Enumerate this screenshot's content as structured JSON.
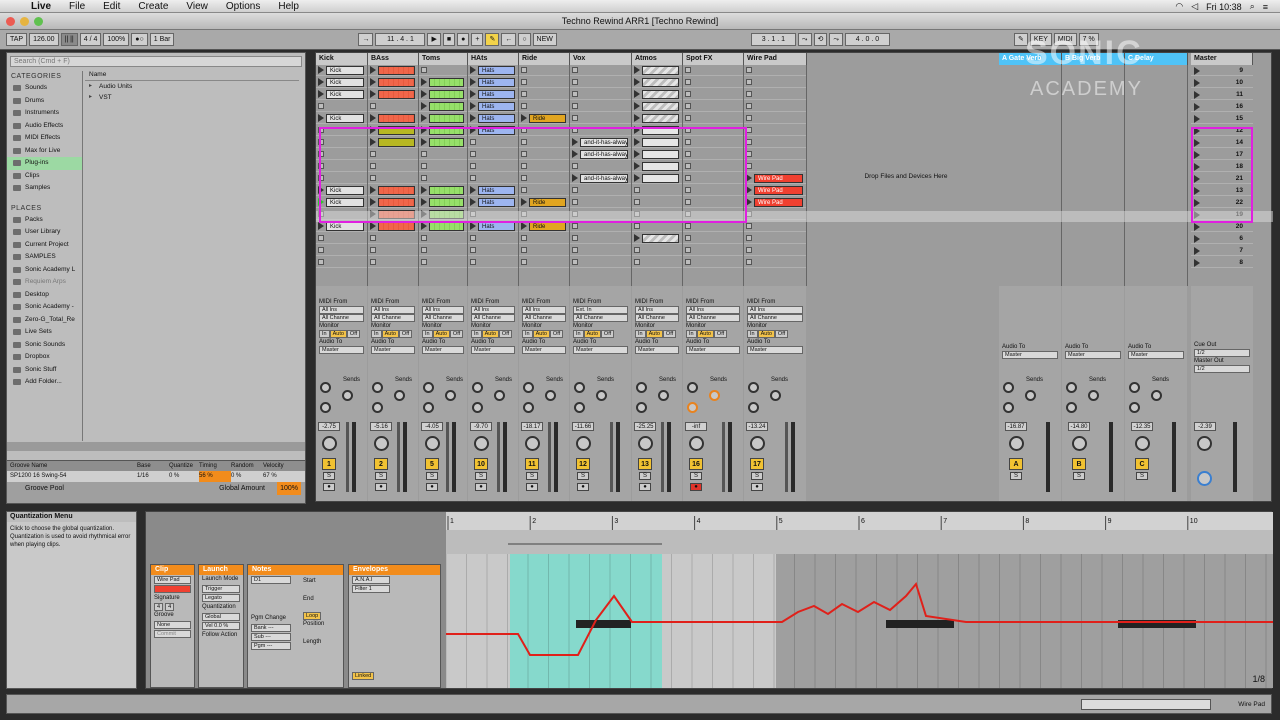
{
  "menubar": {
    "app": "Live",
    "items": [
      "File",
      "Edit",
      "Create",
      "View",
      "Options",
      "Help"
    ],
    "clock": "Fri 10:38"
  },
  "window": {
    "title": "Techno Rewind ARR1  [Techno Rewind]"
  },
  "controlbar": {
    "tap": "TAP",
    "tempo": "126.00",
    "signature": "4 / 4",
    "zoom": "100%",
    "quantize": "1 Bar",
    "position": "11 .  4 .  1",
    "loop_start": "3 .  1 .  1",
    "loop_length": "4 .  0 .  0",
    "new": "NEW",
    "key": "KEY",
    "midi": "MIDI",
    "cpu": "7 %"
  },
  "browser": {
    "search_placeholder": "Search (Cmd + F)",
    "categories_label": "CATEGORIES",
    "categories": [
      "Sounds",
      "Drums",
      "Instruments",
      "Audio Effects",
      "MIDI Effects",
      "Max for Live",
      "Plug-ins",
      "Clips",
      "Samples"
    ],
    "places_label": "PLACES",
    "places": [
      "Packs",
      "User Library",
      "Current Project",
      "SAMPLES",
      "Sonic Academy L",
      "Requiem Arps",
      "Desktop",
      "Sonic Academy -",
      "Zero-G_Total_Re",
      "Live Sets",
      "Sonic Sounds",
      "Dropbox",
      "Sonic Stuff",
      "Add Folder..."
    ],
    "name_header": "Name",
    "items": [
      "Audio Units",
      "VST"
    ]
  },
  "groove": {
    "headers": [
      "Groove Name",
      "Base",
      "Quantize",
      "Timing",
      "Random",
      "Velocity"
    ],
    "row": [
      "SP1200 16 Swing-54",
      "1/16",
      "0 %",
      "56 %",
      "0 %",
      "67 %"
    ],
    "pool": "Groove Pool",
    "global_amount_label": "Global Amount",
    "global_amount": "100%"
  },
  "tracks": [
    {
      "name": "Kick",
      "color": "#d8d8d8",
      "num": "1",
      "vol": "-2.75"
    },
    {
      "name": "BAss",
      "color": "#f0664a",
      "num": "2",
      "vol": "-5.16"
    },
    {
      "name": "Toms",
      "color": "#96e06a",
      "num": "5",
      "vol": "-4.05"
    },
    {
      "name": "HAts",
      "color": "#9db5f0",
      "num": "10",
      "vol": "-9.70"
    },
    {
      "name": "Ride",
      "color": "#e1a520",
      "num": "11",
      "vol": "-18.17"
    },
    {
      "name": "Vox",
      "color": "#d8d8d8",
      "num": "12",
      "vol": "-11.66"
    },
    {
      "name": "Atmos",
      "color": "#e6e6e6",
      "num": "13",
      "vol": "-25.25"
    },
    {
      "name": "Spot FX",
      "color": "#d8d8d8",
      "num": "16",
      "vol": "-inf"
    },
    {
      "name": "Wire Pad",
      "color": "#f04030",
      "num": "17",
      "vol": "-13.24"
    }
  ],
  "clips": {
    "kick": "Kick",
    "hats": "Hats",
    "ride": "Ride",
    "vox": "and-it-has-alway",
    "wire": "Wire Pad"
  },
  "drop_text": "Drop Files and Devices Here",
  "returns": [
    {
      "name": "A Gate Verb",
      "letter": "A",
      "vol": "-16.87"
    },
    {
      "name": "B Big Verb",
      "letter": "B",
      "vol": "-14.80"
    },
    {
      "name": "C Delay",
      "letter": "C",
      "vol": "-12.35"
    }
  ],
  "master": {
    "name": "Master",
    "vol": "-2.39",
    "scenes": [
      "9",
      "10",
      "11",
      "16",
      "15",
      "12",
      "14",
      "17",
      "18",
      "21",
      "13",
      "22",
      "19",
      "20",
      "6",
      "7",
      "8"
    ],
    "cue_out": "Cue Out",
    "master_out": "Master Out",
    "io": "1/2"
  },
  "mixer_labels": {
    "midi_from": "MIDI From",
    "all_ins": "All Ins",
    "all_channels": "All Channe",
    "monitor": "Monitor",
    "in": "In",
    "auto": "Auto",
    "off": "Off",
    "audio_to": "Audio To",
    "master": "Master",
    "sends": "Sends",
    "ext_in": "Ext. In"
  },
  "info": {
    "title": "Quantization Menu",
    "text": "Click to choose the global quantization. Quantization is used to avoid rhythmical error when playing clips."
  },
  "clipview": {
    "clip_title": "Clip",
    "clip_name": "Wire Pad",
    "signature_label": "Signature",
    "sig_num": "4",
    "sig_den": "4",
    "groove_label": "Groove",
    "groove_val": "None",
    "commit": "Commit",
    "launch_title": "Launch",
    "launch_mode_label": "Launch Mode",
    "launch_mode": "Trigger",
    "legato": "Legato",
    "quantization_label": "Quantization",
    "quantization": "Global",
    "vel": "Vel  0.0 %",
    "follow_action": "Follow Action",
    "notes_title": "Notes",
    "note_range": "D1",
    "pgm_change": "Pgm Change",
    "bank": "Bank ---",
    "sub": "Sub ---",
    "pgm": "Pgm ---",
    "start": "Start",
    "end": "End",
    "loop": "Loop",
    "position": "Position",
    "length": "Length",
    "env_title": "Envelopes",
    "env_src": "A.N.A.I",
    "env_ctrl": "Filter 1",
    "linked": "Linked",
    "page": "1/8",
    "ruler": [
      "1",
      "2",
      "3",
      "4",
      "5",
      "6",
      "7",
      "8",
      "9",
      "10"
    ]
  },
  "status": {
    "track": "Wire Pad"
  }
}
